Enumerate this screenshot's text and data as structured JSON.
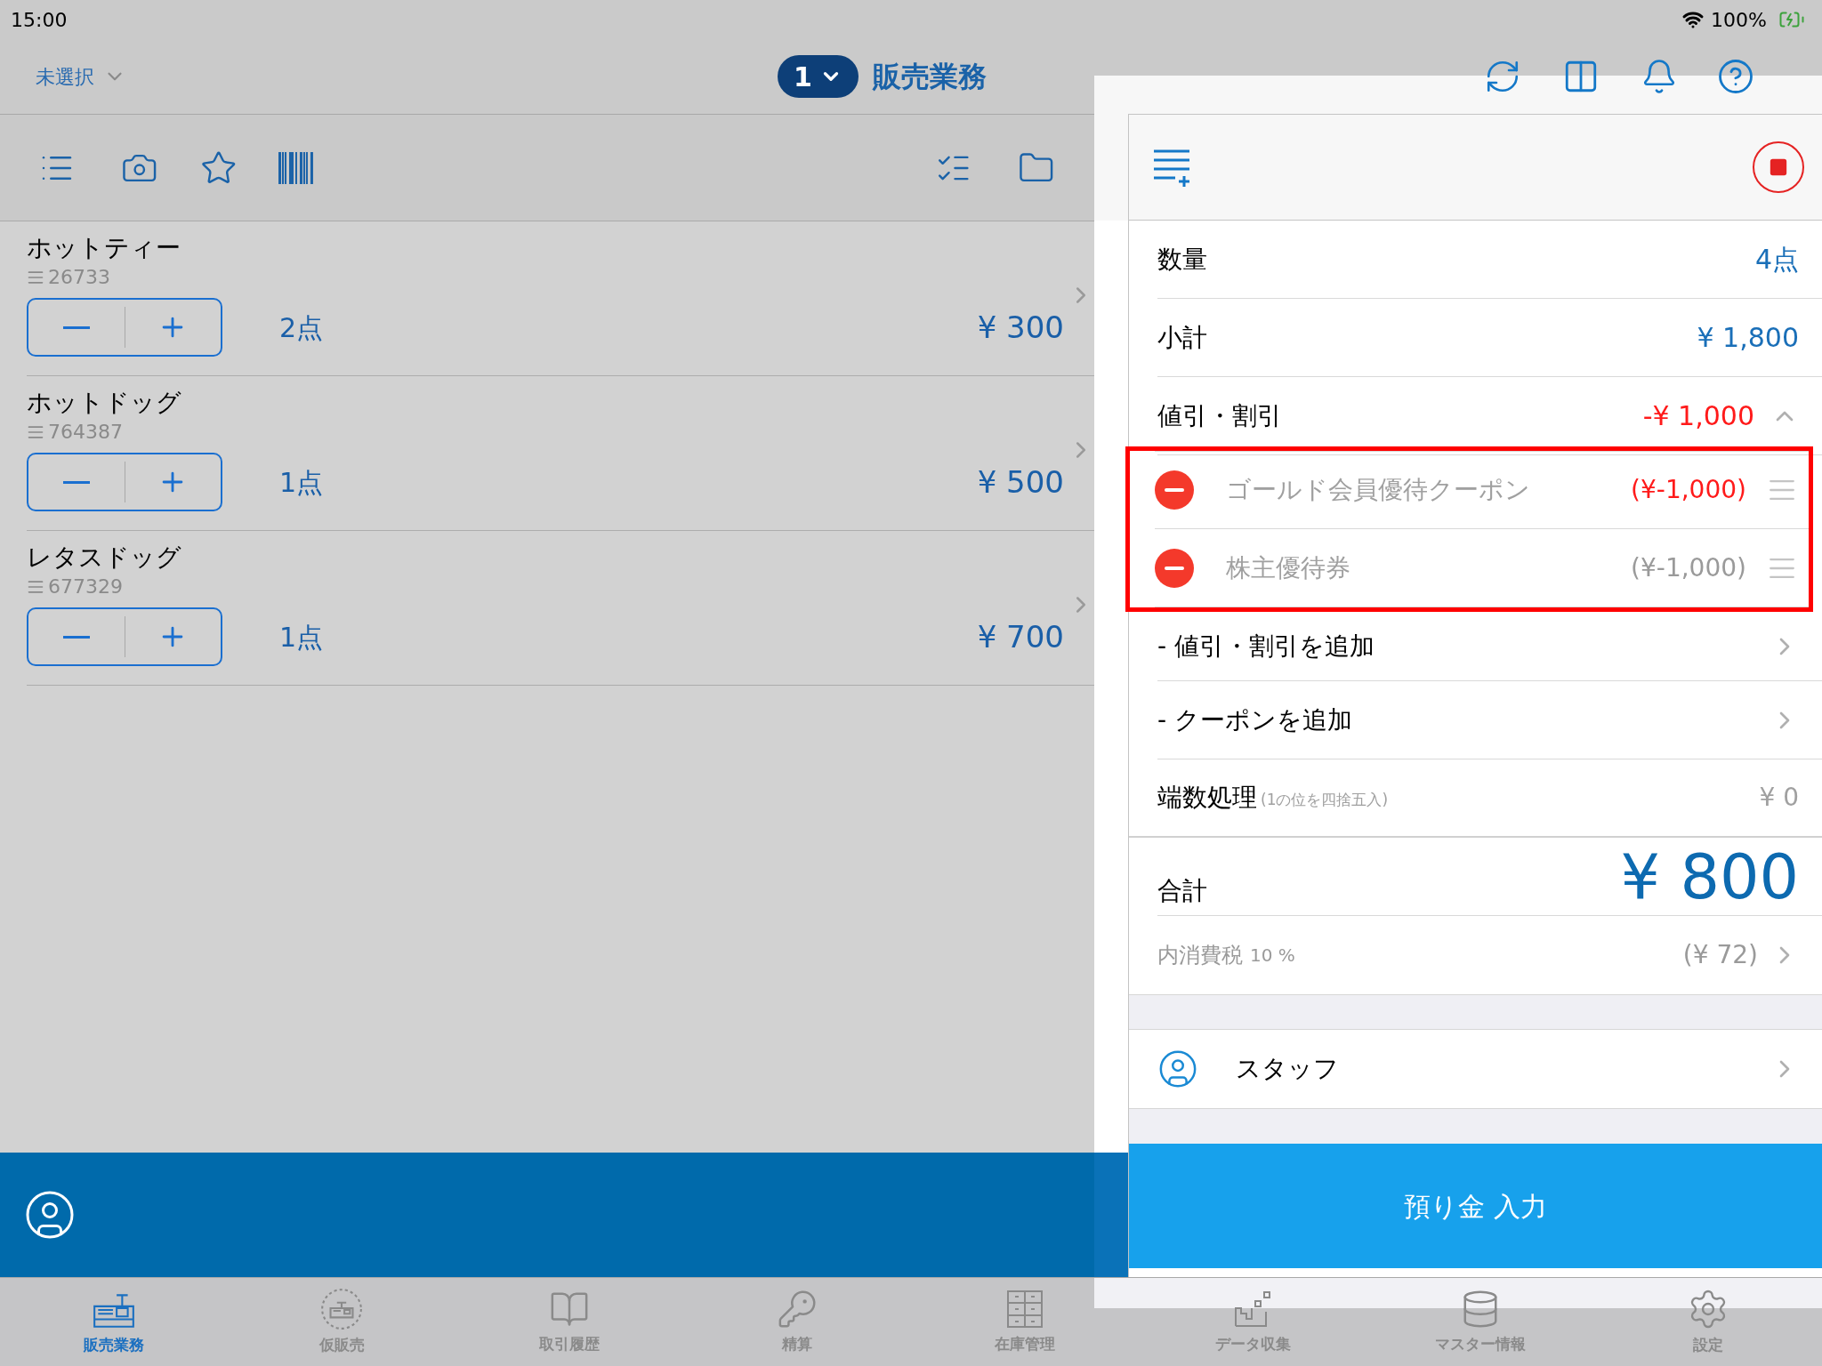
{
  "status_bar": {
    "time": "15:00",
    "battery": "100%"
  },
  "header": {
    "store": "未選択",
    "register_number": "1",
    "title": "販売業務"
  },
  "items": [
    {
      "name": "ホットティー",
      "code": "26733",
      "quantity": "2点",
      "price": "¥ 300"
    },
    {
      "name": "ホットドッグ",
      "code": "764387",
      "quantity": "1点",
      "price": "¥ 500"
    },
    {
      "name": "レタスドッグ",
      "code": "677329",
      "quantity": "1点",
      "price": "¥ 700"
    }
  ],
  "summary": [
    {
      "kind": "value",
      "label": "数量",
      "value": "4点"
    },
    {
      "kind": "value",
      "label": "小計",
      "value": "¥ 1,800"
    },
    {
      "kind": "expander",
      "label": "値引・割引",
      "value": "-¥ 1,000",
      "expanded": true
    }
  ],
  "discounts": [
    {
      "name": "ゴールド会員優待クーポン",
      "amount": "(¥-1,000)",
      "color": "#ff1a1a"
    },
    {
      "name": "株主優待券",
      "amount": "(¥-1,000)",
      "color": "#9a9a9a"
    }
  ],
  "actions": [
    {
      "label": "- 値引・割引を追加"
    },
    {
      "label": "- クーポンを追加"
    }
  ],
  "rounding": {
    "label": "端数処理",
    "note": "(1の位を四捨五入)",
    "value": "¥ 0"
  },
  "total": {
    "label": "合計",
    "value": "¥ 800"
  },
  "tax": {
    "label": "内消費税",
    "rate": "10 %",
    "value": "(¥ 72)"
  },
  "staff": {
    "label": "スタッフ"
  },
  "deposit_button": "預り金 入力",
  "tabs": [
    {
      "label": "販売業務",
      "selected": true
    },
    {
      "label": "仮販売",
      "selected": false
    },
    {
      "label": "取引履歴",
      "selected": false
    },
    {
      "label": "精算",
      "selected": false
    },
    {
      "label": "在庫管理",
      "selected": false
    },
    {
      "label": "データ収集",
      "selected": false
    },
    {
      "label": "マスター情報",
      "selected": false
    },
    {
      "label": "設定",
      "selected": false
    }
  ]
}
